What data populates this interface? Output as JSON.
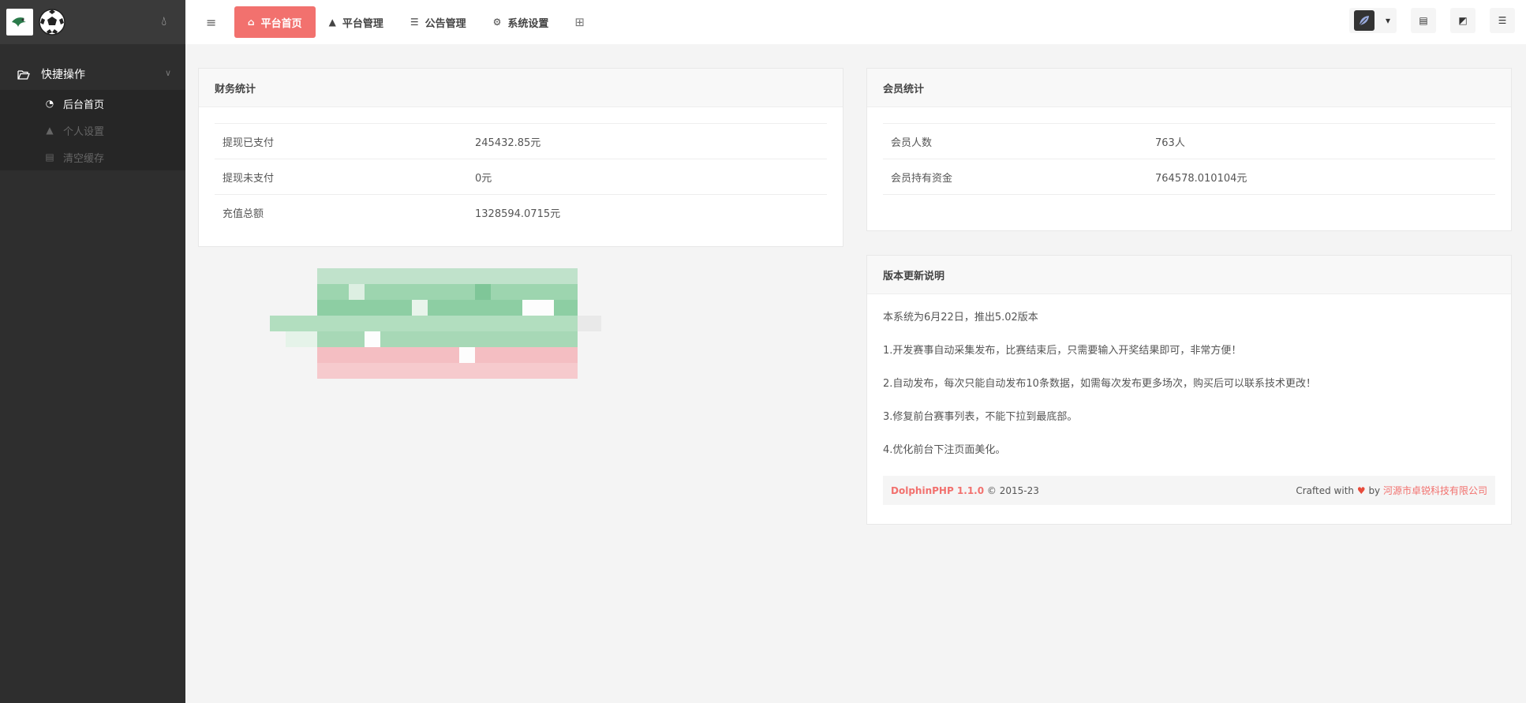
{
  "sidebar": {
    "group_label": "快捷操作",
    "items": [
      {
        "label": "后台首页",
        "icon": "dashboard-icon",
        "active": true
      },
      {
        "label": "个人设置",
        "icon": "user-icon",
        "active": false
      },
      {
        "label": "清空缓存",
        "icon": "trash-icon",
        "active": false
      }
    ]
  },
  "topnav": {
    "items": [
      {
        "label": "平台首页",
        "icon": "home-icon",
        "active": true
      },
      {
        "label": "平台管理",
        "icon": "user-icon",
        "active": false
      },
      {
        "label": "公告管理",
        "icon": "list-icon",
        "active": false
      },
      {
        "label": "系统设置",
        "icon": "gear-icon",
        "active": false
      }
    ]
  },
  "finance": {
    "title": "财务统计",
    "rows": [
      {
        "label": "提现已支付",
        "value": "245432.85元"
      },
      {
        "label": "提现未支付",
        "value": "0元"
      },
      {
        "label": "充值总额",
        "value": "1328594.0715元"
      }
    ]
  },
  "members": {
    "title": "会员统计",
    "rows": [
      {
        "label": "会员人数",
        "value": "763人"
      },
      {
        "label": "会员持有资金",
        "value": "764578.010104元"
      }
    ]
  },
  "updates": {
    "title": "版本更新说明",
    "notes": [
      "本系统为6月22日，推出5.02版本",
      "1.开发赛事自动采集发布，比赛结束后，只需要输入开奖结果即可，非常方便！",
      "2.自动发布，每次只能自动发布10条数据，如需每次发布更多场次，购买后可以联系技术更改！",
      "3.修复前台赛事列表，不能下拉到最底部。",
      "4.优化前台下注页面美化。"
    ],
    "footer": {
      "brand": "DolphinPHP 1.1.0",
      "copyright": "© 2015-23",
      "crafted": "Crafted with",
      "by": "by",
      "company": "河源市卓锐科技有限公司"
    }
  },
  "colors": {
    "accent": "#f2716e",
    "sidebar_bg": "#2e2e2e",
    "page_bg": "#f4f4f4"
  }
}
